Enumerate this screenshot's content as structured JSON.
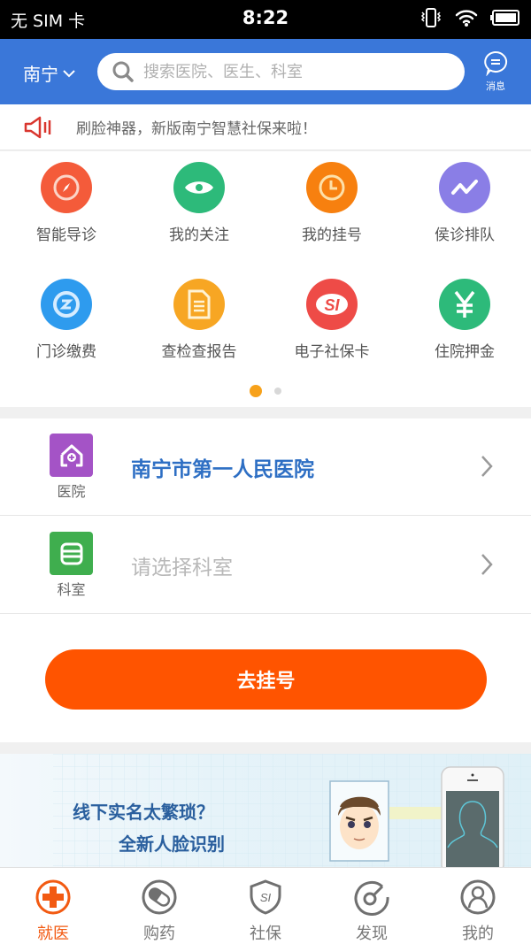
{
  "status_bar": {
    "carrier": "无 SIM 卡",
    "time": "8:22",
    "icons": [
      "vibrate-icon",
      "wifi-icon",
      "battery-icon"
    ]
  },
  "header": {
    "city": "南宁",
    "search_placeholder": "搜索医院、医生、科室",
    "message_label": "消息",
    "color": "#3a77d9"
  },
  "notice": {
    "text": "刷脸神器，新版南宁智慧社保来啦！",
    "icon": "speaker-icon"
  },
  "grid": {
    "items": [
      {
        "label": "智能导诊",
        "icon": "compass-icon",
        "color": "#f45b3a"
      },
      {
        "label": "我的关注",
        "icon": "eye-icon",
        "color": "#2dba7a"
      },
      {
        "label": "我的挂号",
        "icon": "clock-icon",
        "color": "#f7800f"
      },
      {
        "label": "侯诊排队",
        "icon": "trend-icon",
        "color": "#8a7ee6"
      },
      {
        "label": "门诊缴费",
        "icon": "payment-icon",
        "color": "#2e9bee"
      },
      {
        "label": "查检查报告",
        "icon": "document-icon",
        "color": "#f7a623"
      },
      {
        "label": "电子社保卡",
        "icon": "si-card-icon",
        "color": "#ee4b47"
      },
      {
        "label": "住院押金",
        "icon": "yen-icon",
        "color": "#2dba7a"
      }
    ],
    "page": 1,
    "page_count": 2
  },
  "selection": {
    "hospital": {
      "caption": "医院",
      "value": "南宁市第一人民医院",
      "color": "#a453c6"
    },
    "department": {
      "caption": "科室",
      "placeholder": "请选择科室",
      "color": "#3fae4e"
    },
    "submit_label": "去挂号"
  },
  "banner": {
    "line1": "线下实名太繁琐？",
    "line2": "全新人脸识别"
  },
  "tabbar": {
    "items": [
      {
        "label": "就医",
        "icon": "medical-cross-icon",
        "active": true
      },
      {
        "label": "购药",
        "icon": "pill-icon",
        "active": false
      },
      {
        "label": "社保",
        "icon": "shield-si-icon",
        "active": false
      },
      {
        "label": "发现",
        "icon": "discover-icon",
        "active": false
      },
      {
        "label": "我的",
        "icon": "user-icon",
        "active": false
      }
    ]
  }
}
